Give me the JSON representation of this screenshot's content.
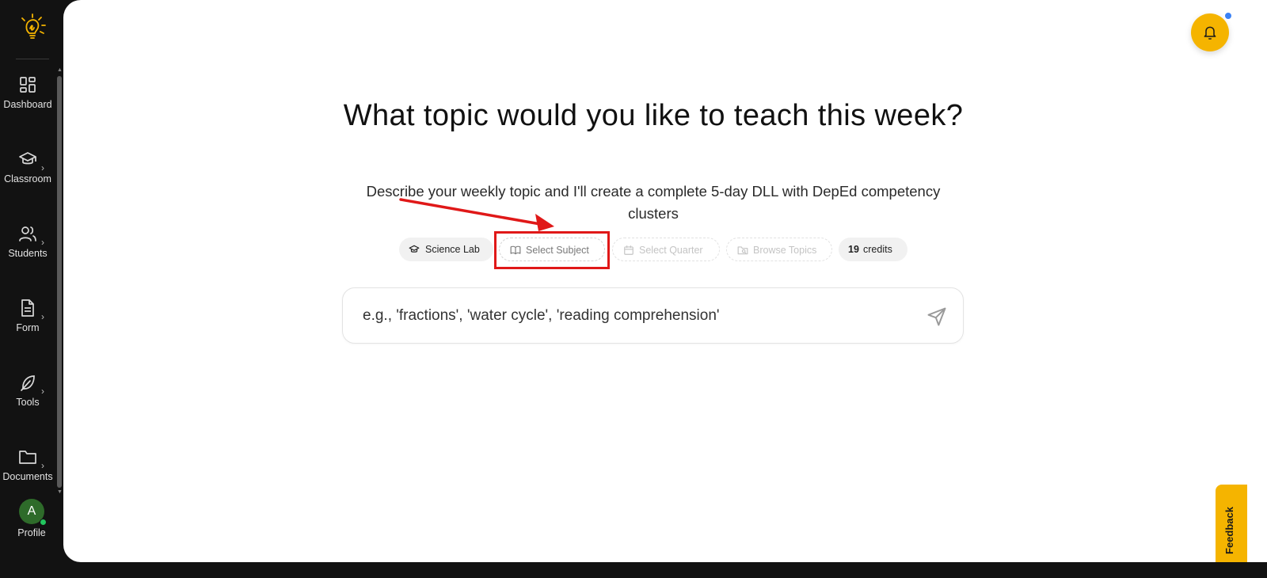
{
  "sidebar": {
    "items": [
      {
        "label": "Dashboard",
        "icon": "dashboard-icon"
      },
      {
        "label": "Classroom",
        "icon": "graduation-cap-icon"
      },
      {
        "label": "Students",
        "icon": "users-icon"
      },
      {
        "label": "Form",
        "icon": "document-icon"
      },
      {
        "label": "Tools",
        "icon": "feather-icon"
      },
      {
        "label": "Documents",
        "icon": "folder-icon"
      }
    ],
    "profile": {
      "initial": "A",
      "label": "Profile"
    }
  },
  "header": {
    "notification_icon": "bell-icon"
  },
  "main": {
    "headline": "What topic would you like to teach this week?",
    "subline": "Describe your weekly topic and I'll create a complete 5-day DLL with DepEd competency clusters",
    "chips": {
      "lab": "Science Lab",
      "subject": "Select Subject",
      "quarter": "Select Quarter",
      "topics": "Browse Topics",
      "credits_count": "19",
      "credits_label": "credits"
    },
    "input_placeholder": "e.g., 'fractions', 'water cycle', 'reading comprehension'"
  },
  "feedback_label": "Feedback",
  "colors": {
    "accent": "#f5b400",
    "sidebar": "#121212",
    "annotation": "#e01818",
    "notification_dot": "#3b82f6",
    "online": "#22c55e"
  }
}
